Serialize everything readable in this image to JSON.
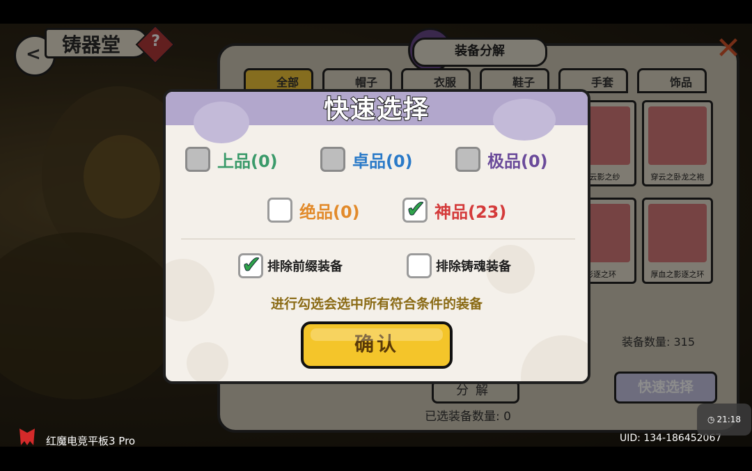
{
  "hall": {
    "title": "铸器堂",
    "help": "?",
    "back": "<"
  },
  "panel": {
    "title": "装备分解",
    "close": "✕",
    "tabs": [
      "全部",
      "帽子",
      "衣服",
      "鞋子",
      "手套",
      "饰品"
    ],
    "items": [
      "穿云影之纱",
      "穿云之卧龙之袍",
      "影逐之环",
      "厚血之影逐之环"
    ],
    "equip_count": "装备数量: 315",
    "decompose": "分解",
    "quick_select": "快速选择",
    "selected_count": "已选装备数量: 0"
  },
  "modal": {
    "title": "快速选择",
    "grades": [
      {
        "label": "上品(0)",
        "color": "#3a9a6a",
        "checked": false,
        "disabled": true
      },
      {
        "label": "卓品(0)",
        "color": "#2a7ac8",
        "checked": false,
        "disabled": true
      },
      {
        "label": "极品(0)",
        "color": "#6a4a9a",
        "checked": false,
        "disabled": true
      },
      {
        "label": "绝品(0)",
        "color": "#e28a2a",
        "checked": false,
        "disabled": false
      },
      {
        "label": "神品(23)",
        "color": "#d43a3a",
        "checked": true,
        "disabled": false
      }
    ],
    "exclude_prefix": "排除前缀装备",
    "exclude_prefix_checked": true,
    "exclude_soul": "排除铸魂装备",
    "exclude_soul_checked": false,
    "hint": "进行勾选会选中所有符合条件的装备",
    "confirm": "确认"
  },
  "device": {
    "name": "红魔电竞平板3 Pro",
    "uid": "UID: 134-186452067",
    "time": "21:18"
  }
}
